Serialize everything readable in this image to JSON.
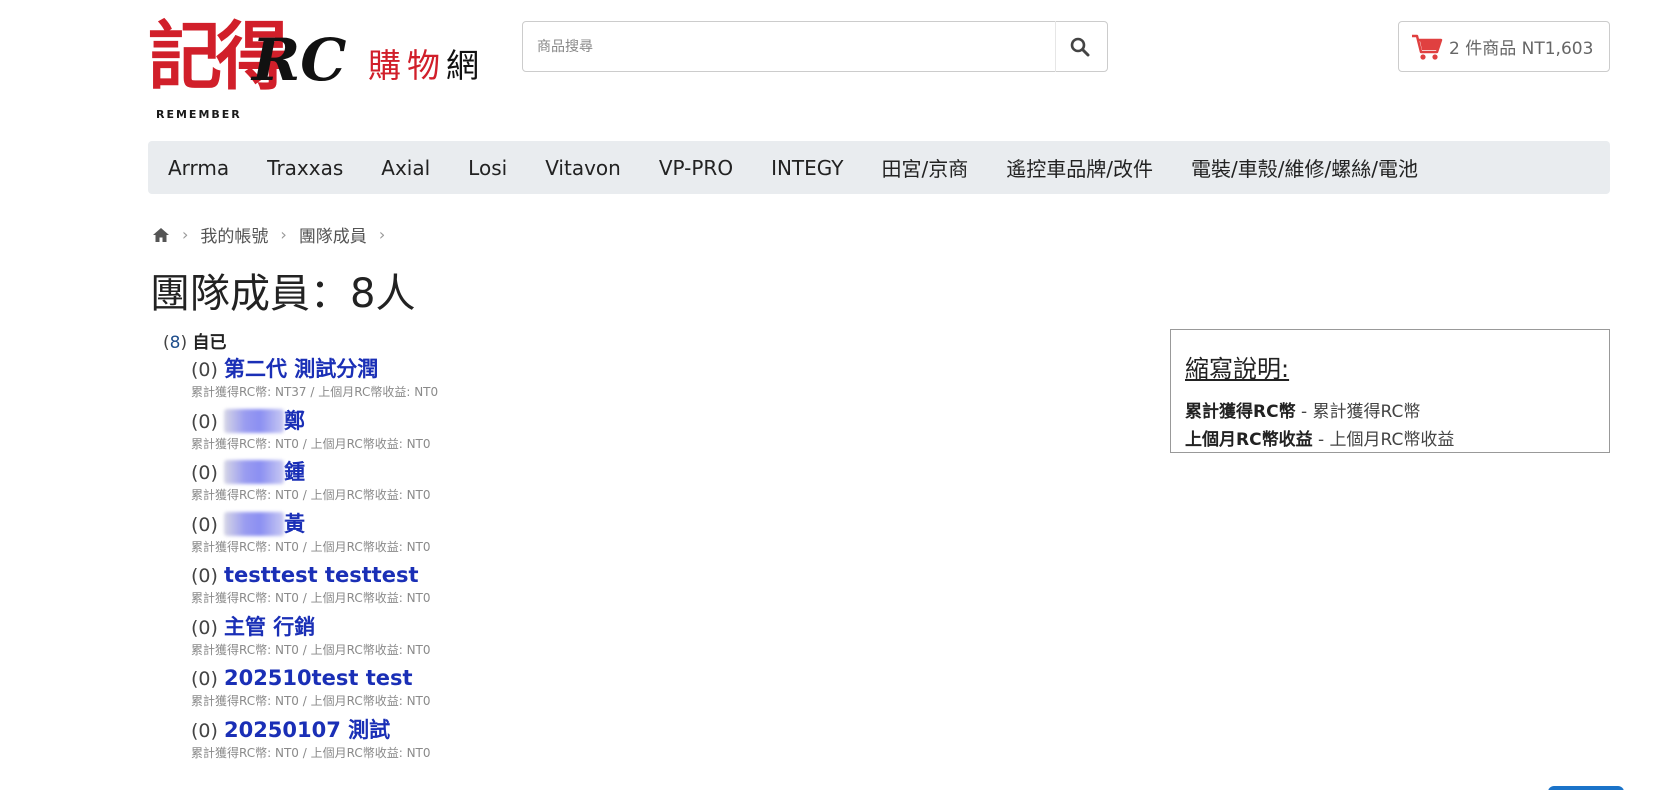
{
  "header": {
    "logo_mark": "記得",
    "logo_sub": "REMEMBER",
    "logo_rc": "RC",
    "logo_shop_red": "購物",
    "logo_shop_black": "網",
    "search_placeholder": "商品搜尋",
    "cart_text": "2 件商品 NT1,603"
  },
  "nav": {
    "items": [
      "Arrma",
      "Traxxas",
      "Axial",
      "Losi",
      "Vitavon",
      "VP-PRO",
      "INTEGY",
      "田宮/京商",
      "遙控車品牌/改件",
      "電裝/車殼/維修/螺絲/電池"
    ]
  },
  "breadcrumb": {
    "items": [
      "我的帳號",
      "團隊成員"
    ]
  },
  "page": {
    "title": "團隊成員：8人"
  },
  "tree": {
    "root_count": "8",
    "root_name": "自已",
    "members": [
      {
        "count": "(0)",
        "name": "第二代 測試分潤",
        "stats": "累計獲得RC幣: NT37 / 上個月RC幣收益: NT0"
      },
      {
        "count": "(0)",
        "name": "鄭",
        "stats": "累計獲得RC幣: NT0 / 上個月RC幣收益: NT0"
      },
      {
        "count": "(0)",
        "name": "鍾",
        "stats": "累計獲得RC幣: NT0 / 上個月RC幣收益: NT0"
      },
      {
        "count": "(0)",
        "name": "黃",
        "stats": "累計獲得RC幣: NT0 / 上個月RC幣收益: NT0"
      },
      {
        "count": "(0)",
        "name": "testtest testtest",
        "stats": "累計獲得RC幣: NT0 / 上個月RC幣收益: NT0"
      },
      {
        "count": "(0)",
        "name": "主管 行銷",
        "stats": "累計獲得RC幣: NT0 / 上個月RC幣收益: NT0"
      },
      {
        "count": "(0)",
        "name": "202510test test",
        "stats": "累計獲得RC幣: NT0 / 上個月RC幣收益: NT0"
      },
      {
        "count": "(0)",
        "name": "20250107 測試",
        "stats": "累計獲得RC幣: NT0 / 上個月RC幣收益: NT0"
      }
    ]
  },
  "legend": {
    "title": "縮寫說明:",
    "rows": [
      {
        "term": "累計獲得RC幣",
        "desc": " - 累計獲得RC幣"
      },
      {
        "term": "上個月RC幣收益",
        "desc": " - 上個月RC幣收益"
      }
    ]
  },
  "colors": {
    "brand_red": "#d11f2a",
    "member_link": "#1a2fb6",
    "nav_bg": "#e9ecef"
  }
}
